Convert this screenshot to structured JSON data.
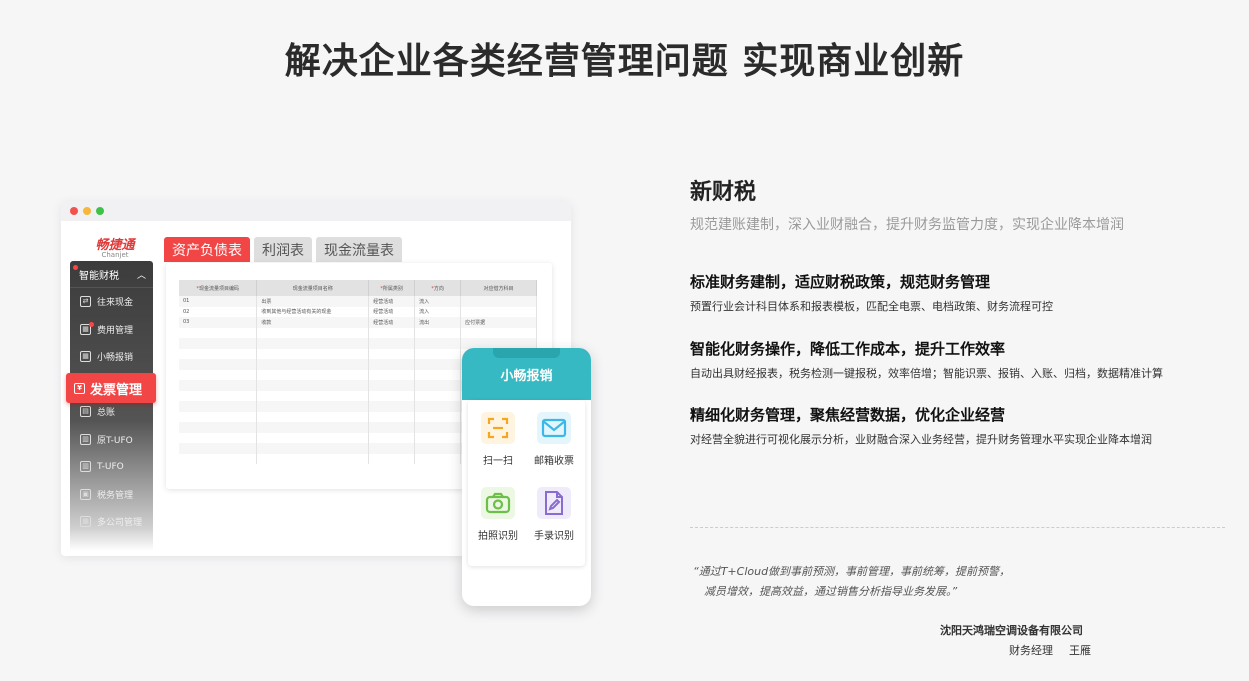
{
  "headline": "解决企业各类经营管理问题 实现商业创新",
  "app": {
    "logo_cn": "畅捷通",
    "logo_en": "Chanjet",
    "sidebar_header": "智能财税",
    "sidebar_items": [
      "往来现金",
      "费用管理",
      "小畅报销",
      "发票管理",
      "总账",
      "原T-UFO",
      "T-UFO",
      "税务管理",
      "多公司管理"
    ],
    "active_item": "发票管理",
    "tabs": [
      "资产负债表",
      "利润表",
      "现金流量表"
    ],
    "table": {
      "headers": [
        "现金流量项目编码",
        "现金流量项目名称",
        "所属类别",
        "方向",
        "对应借方科目"
      ],
      "rows": [
        [
          "01",
          "出票",
          "经营活动",
          "流入",
          ""
        ],
        [
          "02",
          "收到其他与经营活动有关的现金",
          "经营活动",
          "流入",
          ""
        ],
        [
          "03",
          "收款",
          "经营活动",
          "流出",
          "应付票据"
        ]
      ]
    }
  },
  "phone": {
    "title": "小畅报销",
    "features": [
      {
        "label": "扫一扫",
        "icon": "scan-icon",
        "color": "#f5a623"
      },
      {
        "label": "邮箱收票",
        "icon": "mail-icon",
        "color": "#3cb8e8"
      },
      {
        "label": "拍照识别",
        "icon": "camera-icon",
        "color": "#6cc04a"
      },
      {
        "label": "手录识别",
        "icon": "document-edit-icon",
        "color": "#8a6cd0"
      }
    ]
  },
  "right": {
    "title": "新财税",
    "subtitle": "规范建账建制，深入业财融合，提升财务监管力度，实现企业降本增润",
    "features": [
      {
        "heading": "标准财务建制，适应财税政策，规范财务管理",
        "desc": "预置行业会计科目体系和报表模板，匹配全电票、电档政策、财务流程可控"
      },
      {
        "heading": "智能化财务操作，降低工作成本，提升工作效率",
        "desc": "自动出具财经报表，税务检测一键报税，效率倍增；智能识票、报销、入账、归档，数据精准计算"
      },
      {
        "heading": "精细化财务管理，聚焦经营数据，优化企业经营",
        "desc": "对经营全貌进行可视化展示分析，业财融合深入业务经营，提升财务管理水平实现企业降本增润"
      }
    ],
    "quote_line1": "“通过T+Cloud做到事前预测，事前管理，事前统筹，提前预警，",
    "quote_line2": "减员增效，提高效益，通过销售分析指导业务发展。”",
    "company": "沈阳天鸿瑞空调设备有限公司",
    "role": "财务经理",
    "person": "王雁"
  }
}
